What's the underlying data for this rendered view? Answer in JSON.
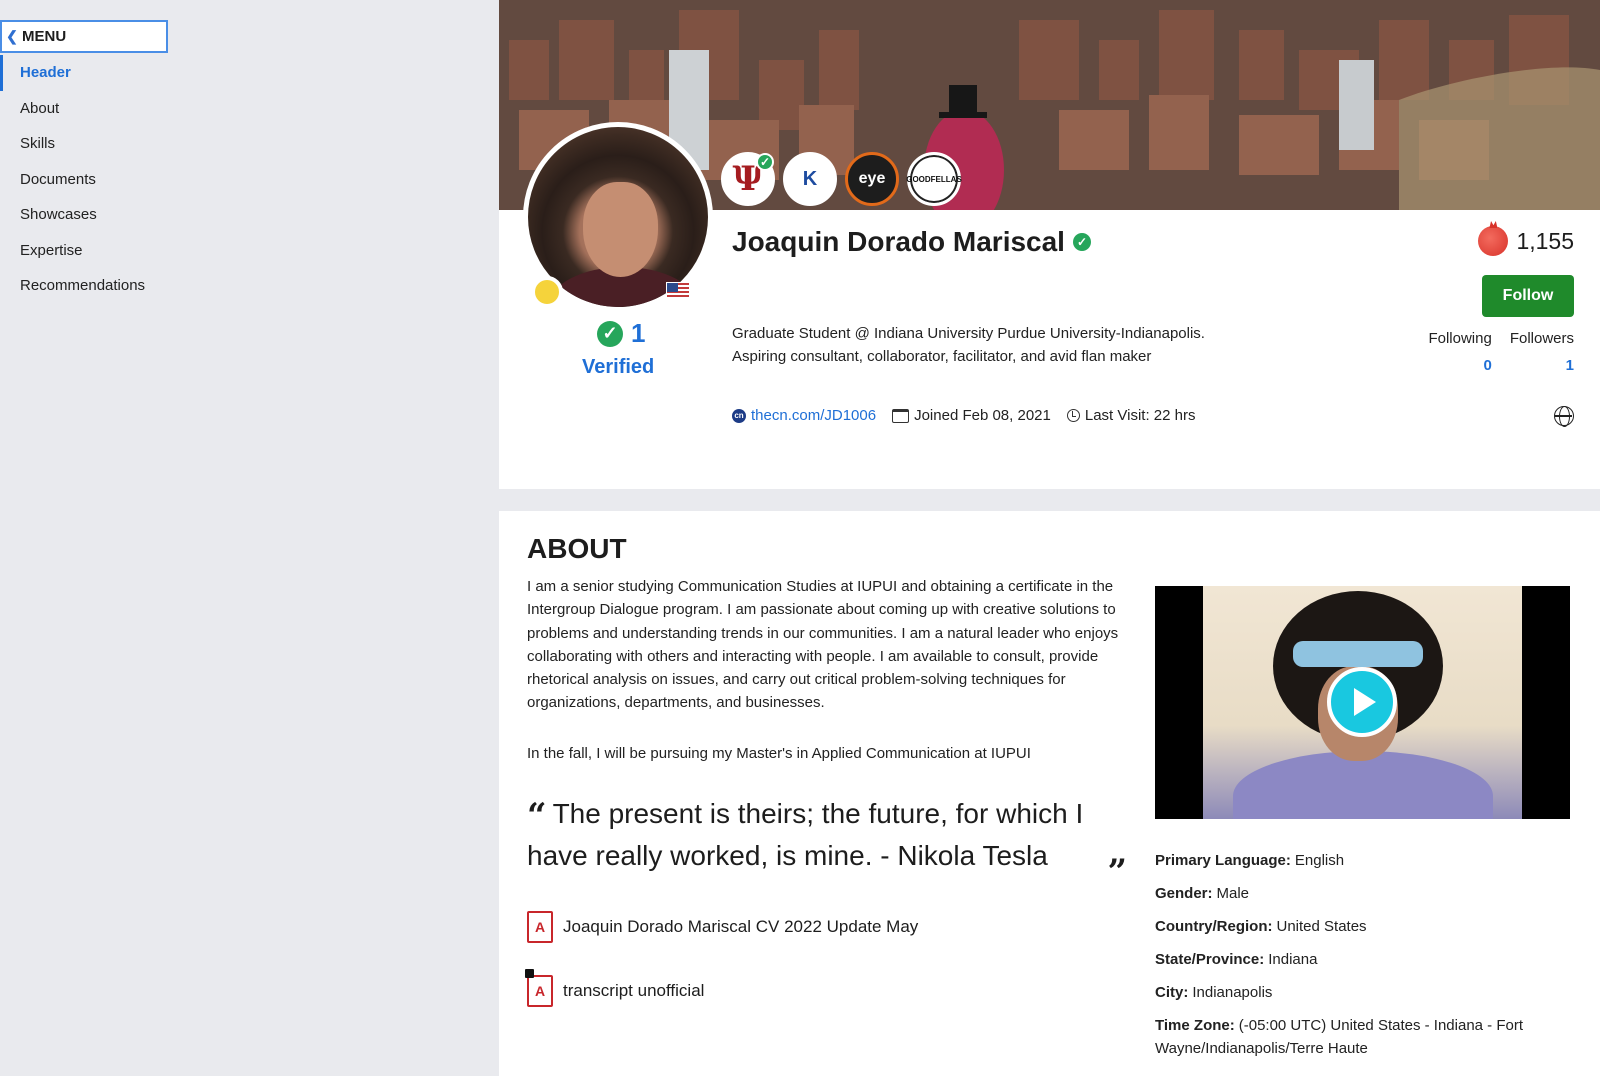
{
  "sidebar": {
    "menu_label": "MENU",
    "items": [
      {
        "label": "Header",
        "active": true
      },
      {
        "label": "About"
      },
      {
        "label": "Skills"
      },
      {
        "label": "Documents"
      },
      {
        "label": "Showcases"
      },
      {
        "label": "Expertise"
      },
      {
        "label": "Recommendations"
      }
    ]
  },
  "profile": {
    "name": "Joaquin Dorado Mariscal",
    "verified_count": "1",
    "verified_label": "Verified",
    "bio_line1": "Graduate Student @ Indiana University Purdue University-Indianapolis.",
    "bio_line2": "Aspiring consultant, collaborator, facilitator, and avid flan maker",
    "link": "thecn.com/JD1006",
    "joined": "Joined Feb 08, 2021",
    "last_visit": "Last Visit: 22 hrs",
    "points": "1,155",
    "follow_label": "Follow",
    "following_label": "Following",
    "following_count": "0",
    "followers_label": "Followers",
    "followers_count": "1",
    "badges": [
      "indiana-university-badge",
      "k-logo-badge",
      "eye-badge",
      "goodfellas-badge"
    ]
  },
  "about": {
    "title": "ABOUT",
    "text": "I am a senior studying Communication Studies at IUPUI and obtaining a certificate in the Intergroup Dialogue program. I am passionate about coming up with creative solutions to problems and understanding trends in our communities. I am a natural leader who enjoys collaborating with others and interacting with people. I am available to consult, provide rhetorical analysis on issues, and carry out critical problem-solving techniques for organizations, departments, and businesses.",
    "text2": "In the fall, I will be pursuing my Master's in Applied Communication at IUPUI",
    "quote": "The present is theirs; the future, for which I have really worked, is mine. - Nikola Tesla",
    "documents": [
      {
        "name": "Joaquin Dorado Mariscal CV 2022 Update May",
        "locked": false
      },
      {
        "name": "transcript unofficial",
        "locked": true
      }
    ],
    "details": [
      {
        "label": "Primary Language:",
        "value": "English"
      },
      {
        "label": "Gender:",
        "value": "Male"
      },
      {
        "label": "Country/Region:",
        "value": "United States"
      },
      {
        "label": "State/Province:",
        "value": "Indiana"
      },
      {
        "label": "City:",
        "value": "Indianapolis"
      },
      {
        "label": "Time Zone:",
        "value": "(-05:00 UTC) United States - Indiana - Fort Wayne/Indianapolis/Terre Haute"
      }
    ]
  },
  "colors": {
    "accent": "#1f6fd6",
    "follow_button": "#1f8a2b",
    "verified_green": "#26a65b",
    "page_bg": "#e9eaee"
  }
}
